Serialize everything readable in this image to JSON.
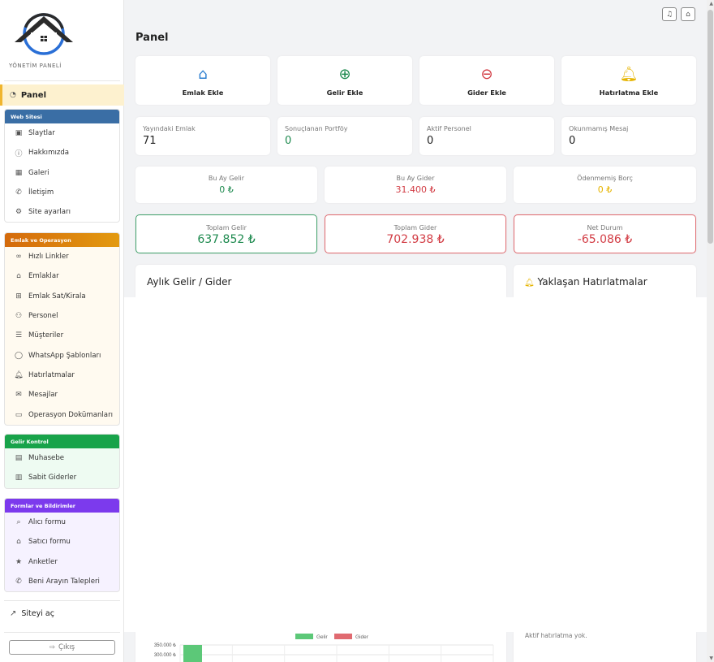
{
  "sidebar": {
    "logo_text": "YÖNETİM PANELİ",
    "panel_label": "Panel",
    "groups": {
      "web": {
        "title": "Web Sitesi",
        "items": [
          "Slaytlar",
          "Hakkımızda",
          "Galeri",
          "İletişim",
          "Site ayarları"
        ]
      },
      "ops": {
        "title": "Emlak ve Operasyon",
        "items": [
          "Hızlı Linkler",
          "Emlaklar",
          "Emlak Sat/Kirala",
          "Personel",
          "Müşteriler",
          "WhatsApp Şablonları",
          "Hatırlatmalar",
          "Mesajlar",
          "Operasyon Dokümanları"
        ]
      },
      "gelir": {
        "title": "Gelir Kontrol",
        "items": [
          "Muhasebe",
          "Sabit Giderler"
        ]
      },
      "form": {
        "title": "Formlar ve Bildirimler",
        "items": [
          "Alıcı formu",
          "Satıcı formu",
          "Anketler",
          "Beni Arayın Talepleri"
        ]
      }
    },
    "site_open": "Siteyi aç",
    "exit": "Çıkış"
  },
  "main": {
    "title": "Panel",
    "actions": [
      "Emlak Ekle",
      "Gelir Ekle",
      "Gider Ekle",
      "Hatırlatma Ekle"
    ],
    "stats": [
      {
        "label": "Yayındaki Emlak",
        "value": "71"
      },
      {
        "label": "Sonuçlanan Portföy",
        "value": "0"
      },
      {
        "label": "Aktif Personel",
        "value": "0"
      },
      {
        "label": "Okunmamış Mesaj",
        "value": "0"
      }
    ],
    "month": [
      {
        "label": "Bu Ay Gelir",
        "value": "0 ₺"
      },
      {
        "label": "Bu Ay Gider",
        "value": "31.400 ₺"
      },
      {
        "label": "Ödenmemiş Borç",
        "value": "0 ₺"
      }
    ],
    "totals": [
      {
        "label": "Toplam Gelir",
        "value": "637.852 ₺"
      },
      {
        "label": "Toplam Gider",
        "value": "702.938 ₺"
      },
      {
        "label": "Net Durum",
        "value": "-65.086 ₺"
      }
    ],
    "chart_title": "Aylık Gelir / Gider",
    "reminders_title": "Yaklaşan Hatırlatmalar",
    "no_reminder": "Aktif hatırlatma yok."
  },
  "chart_data": {
    "type": "bar",
    "title": "Aylık Gelir / Gider",
    "series": [
      {
        "name": "Gelir",
        "values": [
          300000
        ]
      },
      {
        "name": "Gider",
        "values": []
      }
    ],
    "y_ticks": [
      "350.000 ₺",
      "300.000 ₺"
    ],
    "colors": {
      "Gelir": "#5cc878",
      "Gider": "#e06a70"
    }
  },
  "colors": {
    "accent_blue": "#2d7fd0",
    "green": "#1e8a4f",
    "red": "#d23c44",
    "amber": "#e6b400"
  }
}
